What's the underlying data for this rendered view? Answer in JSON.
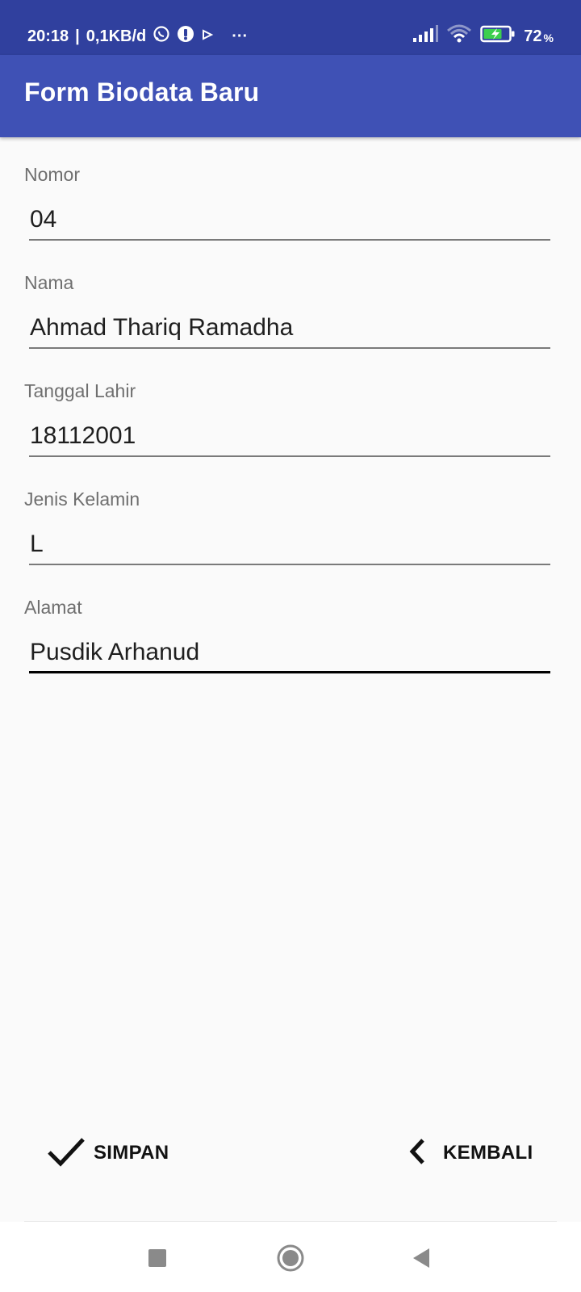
{
  "status_bar": {
    "time": "20:18",
    "separator": "|",
    "data_rate": "0,1KB/d",
    "more": "···",
    "battery_percent": "72",
    "battery_unit": "%",
    "icons": [
      "whatsapp-icon",
      "vpn-icon",
      "play-icon",
      "signal-icon",
      "wifi-icon",
      "battery-charging-icon"
    ]
  },
  "app_bar": {
    "title": "Form Biodata Baru"
  },
  "form": {
    "fields": [
      {
        "label": "Nomor",
        "value": "04"
      },
      {
        "label": "Nama",
        "value": "Ahmad Thariq Ramadha"
      },
      {
        "label": "Tanggal Lahir",
        "value": "18112001"
      },
      {
        "label": "Jenis Kelamin",
        "value": "L"
      },
      {
        "label": "Alamat",
        "value": "Pusdik Arhanud",
        "focused": true
      }
    ]
  },
  "actions": {
    "save_label": "SIMPAN",
    "save_icon": "check-icon",
    "back_label": "KEMBALI",
    "back_icon": "chevron-left-icon"
  },
  "nav_bar": {
    "icons": [
      "recents-icon",
      "home-icon",
      "back-icon"
    ]
  },
  "colors": {
    "status_bar": "#30409e",
    "app_bar": "#3f51b5",
    "background": "#fafafa",
    "battery_charge": "#3ccf4e"
  }
}
